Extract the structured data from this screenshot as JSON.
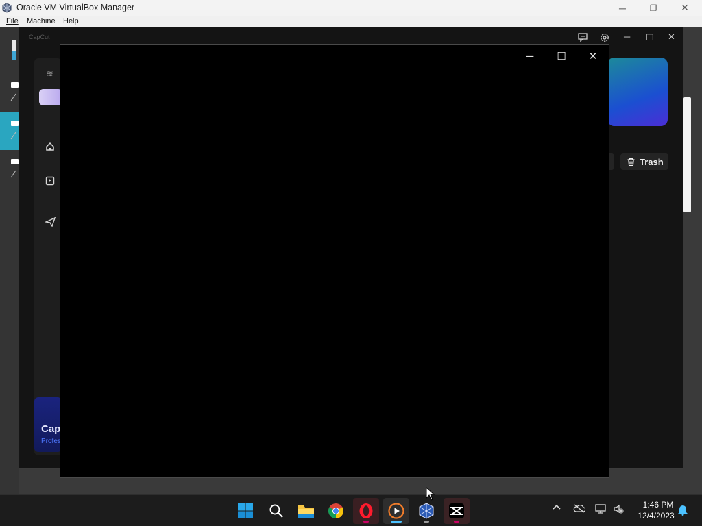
{
  "vbox": {
    "title": "Oracle VM VirtualBox Manager",
    "menu": [
      "File",
      "Machine",
      "Help"
    ],
    "controls": {
      "minimize": "─",
      "restore": "❐",
      "close": "✕"
    }
  },
  "capcut": {
    "brand": "CapCut",
    "trash_label": "Trash",
    "promo_title": "CapC",
    "promo_sub": "Profes"
  },
  "dialog": {
    "controls": {
      "minimize": "─",
      "maximize": "☐",
      "close": "✕"
    }
  },
  "taskbar": {
    "apps": [
      "start",
      "search",
      "file-explorer",
      "chrome",
      "opera",
      "media-player",
      "virtualbox",
      "capcut"
    ],
    "time": "1:46 PM",
    "date": "12/4/2023"
  },
  "colors": {
    "dialog_bg": "#000000",
    "banner_gradient": [
      "#1c8a9a",
      "#1b4fd1",
      "#4a2ed6"
    ],
    "promo_accent": "#4f79ff",
    "taskbar_active_dot": "#4cc2ff"
  }
}
